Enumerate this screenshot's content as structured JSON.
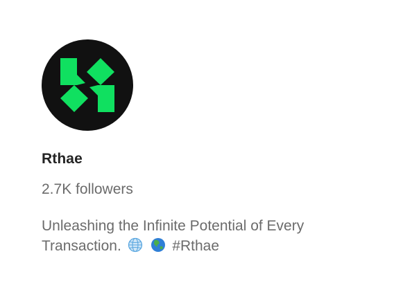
{
  "profile": {
    "name": "Rthae",
    "followers": "2.7K followers",
    "avatar_icon": "rthae-logo-icon",
    "avatar_bg": "#111111",
    "logo_color": "#10e060",
    "bio_line1": "Unleashing the Infinite Potential of Every",
    "bio_line2_text": "Transaction.",
    "bio_emoji_1": "globe-with-meridians-icon",
    "bio_emoji_2": "globe-asia-australia-icon",
    "bio_hashtag": "#Rthae"
  },
  "colors": {
    "name_text": "#242424",
    "secondary_text": "#6b6b6b",
    "background": "#ffffff"
  }
}
